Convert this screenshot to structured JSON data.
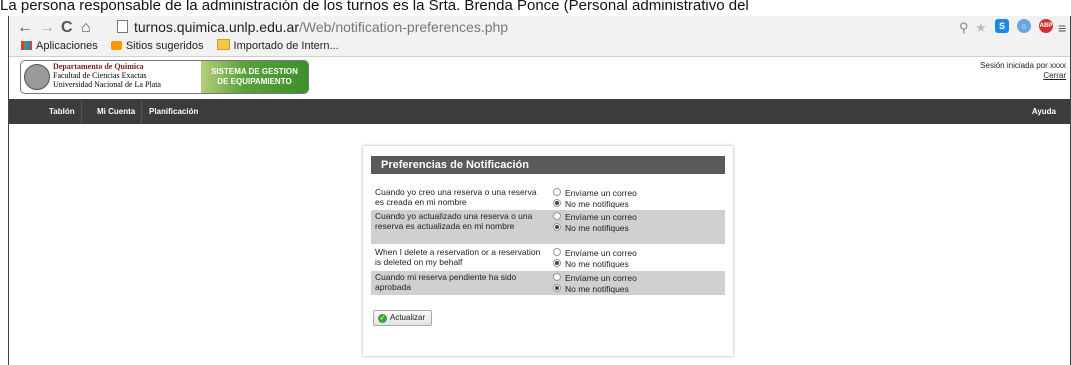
{
  "caption": "La persona responsable de la administración de los turnos es la Srta. Brenda Ponce (Personal administrativo del",
  "browser": {
    "url_host": "turnos.quimica.unlp.edu.ar",
    "url_path": "/Web/notification-preferences.php",
    "bookmarks": [
      "Aplicaciones",
      "Sitios sugeridos",
      "Importado de Intern..."
    ]
  },
  "site": {
    "dept_title": "Departamento de Quimica",
    "dept_line2": "Facultad de Ciencias Exactas",
    "dept_line3": "Universidad Nacional de La Plata",
    "system_line1": "SISTEMA DE GESTION",
    "system_line2": "DE EQUIPAMIENTO",
    "session_text": "Sesión iniciada por xxxx",
    "logout": "Cerrar"
  },
  "menu": {
    "items": [
      "Tablón",
      "Mi Cuenta",
      "Planificación"
    ],
    "help": "Ayuda"
  },
  "panel": {
    "title": "Preferencias de Notificación",
    "option_email": "Envíame un correo",
    "option_none": "No me notifiques",
    "rows": [
      {
        "label": "Cuando yo creo una reserva o una reserva es creada en mi nombre",
        "selected": "none"
      },
      {
        "label": "Cuando yo actualizado una reserva o una reserva es actualizada en mi nombre",
        "selected": "none"
      },
      {
        "label": "When I delete a reservation or a reservation is deleted on my behalf",
        "selected": "none"
      },
      {
        "label": "Cuando mi reserva pendiente ha sido aprobada",
        "selected": "none"
      }
    ],
    "update_label": "Actualizar"
  }
}
